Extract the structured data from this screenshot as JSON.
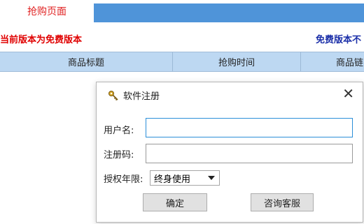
{
  "tabs": {
    "active_label": "抢购页面"
  },
  "notices": {
    "left": "当前版本为免费版本",
    "right": "免费版本不"
  },
  "table": {
    "headers": [
      "商品标题",
      "抢购时间",
      "商品链"
    ]
  },
  "dialog": {
    "title": "软件注册",
    "close_glyph": "✕",
    "username_label": "用户名:",
    "username_value": "",
    "code_label": "注册码:",
    "code_value": "",
    "term_label": "授权年限:",
    "term_selected": "终身使用",
    "ok_label": "确定",
    "service_label": "咨询客服"
  },
  "colors": {
    "accent_blue": "#4f94d9",
    "notice_red": "#e00000",
    "notice_blue": "#1a2ea8",
    "header_bg": "#bdd8f2"
  },
  "icons": {
    "title_icon": "key-icon",
    "select_arrow": "dropdown-arrow-icon"
  }
}
